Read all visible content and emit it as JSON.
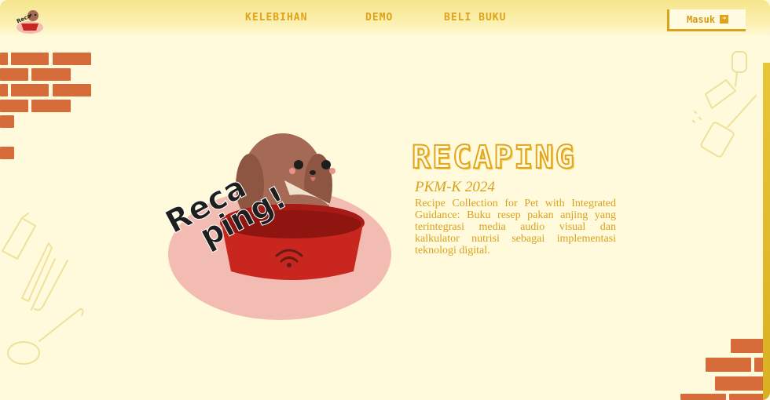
{
  "header": {
    "nav": [
      {
        "label": "KELEBIHAN"
      },
      {
        "label": "DEMO"
      },
      {
        "label": "BELI BUKU"
      }
    ],
    "login_label": "Masuk"
  },
  "logo": {
    "icon": "dog-bowl-logo-icon",
    "text": "Recaping"
  },
  "hero": {
    "title": "RECAPING",
    "subtitle": "PKM-K 2024",
    "description": "Recipe Collection for Pet with Integrated Guidance: Buku resep pakan anjing yang terintegrasi media audio visual dan kalkulator nutrisi sebagai implementasi teknologi digital.",
    "sticker_text_1": "Reca",
    "sticker_text_2": "ping!"
  },
  "colors": {
    "background": "#fffadc",
    "accent": "#e0a21a",
    "brick": "#d56c3a",
    "bowl": "#c8261e",
    "hero_circle": "#f3bcb2"
  }
}
